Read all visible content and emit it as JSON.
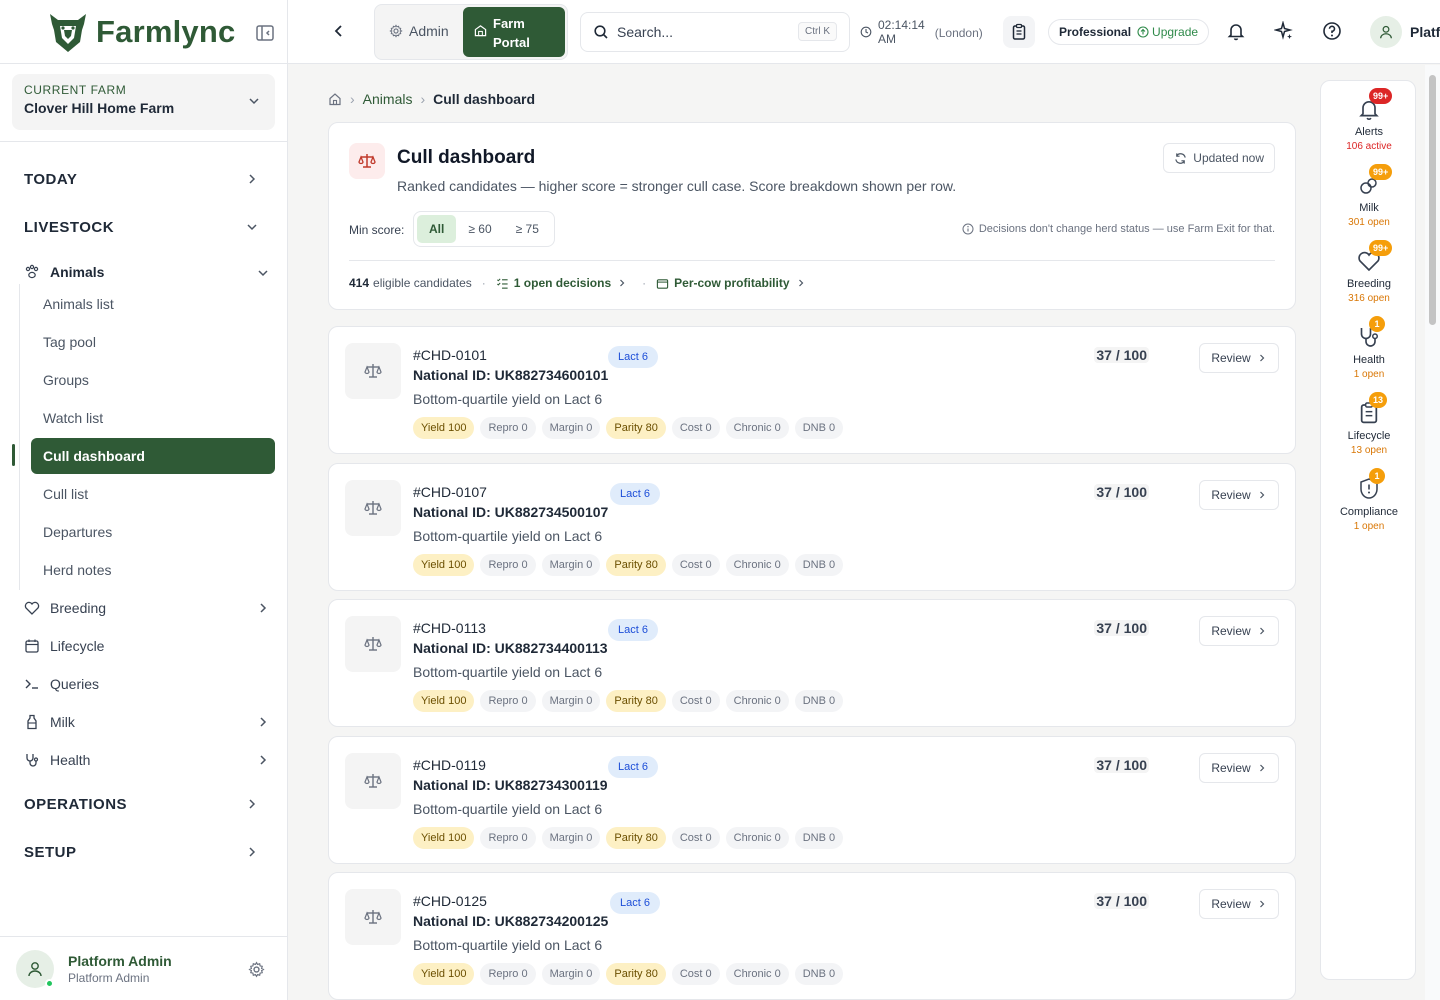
{
  "app": {
    "name": "Farmlync"
  },
  "farm": {
    "label": "CURRENT FARM",
    "name": "Clover Hill Home Farm"
  },
  "nav": {
    "today": "TODAY",
    "livestock": "LIVESTOCK",
    "animals": "Animals",
    "sub": [
      "Animals list",
      "Tag pool",
      "Groups",
      "Watch list",
      "Cull dashboard",
      "Cull list",
      "Departures",
      "Herd notes"
    ],
    "breeding": "Breeding",
    "lifecycle": "Lifecycle",
    "queries": "Queries",
    "milk": "Milk",
    "health": "Health",
    "operations": "OPERATIONS",
    "setup": "SETUP"
  },
  "user": {
    "name": "Platform Admin",
    "role": "Platform Admin",
    "short": "Platf"
  },
  "topbar": {
    "admin": "Admin",
    "farm_portal_1": "Farm",
    "farm_portal_2": "Portal",
    "search_placeholder": "Search...",
    "search_kbd": "Ctrl K",
    "time_1": "02:14:14",
    "time_2": "AM",
    "timezone": "(London)",
    "plan": "Professional",
    "upgrade": "Upgrade"
  },
  "breadcrumb": {
    "parent": "Animals",
    "current": "Cull dashboard"
  },
  "header": {
    "title": "Cull dashboard",
    "subtitle": "Ranked candidates — higher score = stronger cull case. Score breakdown shown per row.",
    "updated": "Updated now",
    "min_score_label": "Min score:",
    "filters": [
      "All",
      "≥ 60",
      "≥ 75"
    ],
    "note": "Decisions don't change herd status — use Farm Exit for that.",
    "eligible_count": "414",
    "eligible_label": "eligible candidates",
    "open_decisions": "1 open decisions",
    "profitability": "Per-cow profitability"
  },
  "rows": [
    {
      "id": "#CHD-0101",
      "lact": "Lact 6",
      "nat_label": "National ID:",
      "nat": "UK882734600101",
      "reason": "Bottom-quartile yield on Lact 6",
      "score": "37 / 100",
      "review": "Review"
    },
    {
      "id": "#CHD-0107",
      "lact": "Lact 6",
      "nat_label": "National ID:",
      "nat": "UK882734500107",
      "reason": "Bottom-quartile yield on Lact 6",
      "score": "37 / 100",
      "review": "Review"
    },
    {
      "id": "#CHD-0113",
      "lact": "Lact 6",
      "nat_label": "National ID:",
      "nat": "UK882734400113",
      "reason": "Bottom-quartile yield on Lact 6",
      "score": "37 / 100",
      "review": "Review"
    },
    {
      "id": "#CHD-0119",
      "lact": "Lact 6",
      "nat_label": "National ID:",
      "nat": "UK882734300119",
      "reason": "Bottom-quartile yield on Lact 6",
      "score": "37 / 100",
      "review": "Review"
    },
    {
      "id": "#CHD-0125",
      "lact": "Lact 6",
      "nat_label": "National ID:",
      "nat": "UK882734200125",
      "reason": "Bottom-quartile yield on Lact 6",
      "score": "37 / 100",
      "review": "Review"
    }
  ],
  "chips": [
    "Yield 100",
    "Repro 0",
    "Margin 0",
    "Parity 80",
    "Cost 0",
    "Chronic 0",
    "DNB 0"
  ],
  "rail": [
    {
      "label": "Alerts",
      "badge": "99+",
      "count": "106 active"
    },
    {
      "label": "Milk",
      "badge": "99+",
      "count": "301 open"
    },
    {
      "label": "Breeding",
      "badge": "99+",
      "count": "316 open"
    },
    {
      "label": "Health",
      "badge": "1",
      "count": "1 open"
    },
    {
      "label": "Lifecycle",
      "badge": "13",
      "count": "13 open"
    },
    {
      "label": "Compliance",
      "badge": "1",
      "count": "1 open"
    }
  ],
  "colors": {
    "brand": "#2f5a36",
    "accent_bg": "#dcefdc",
    "alert": "#dc2626",
    "warn": "#f59e0b"
  }
}
